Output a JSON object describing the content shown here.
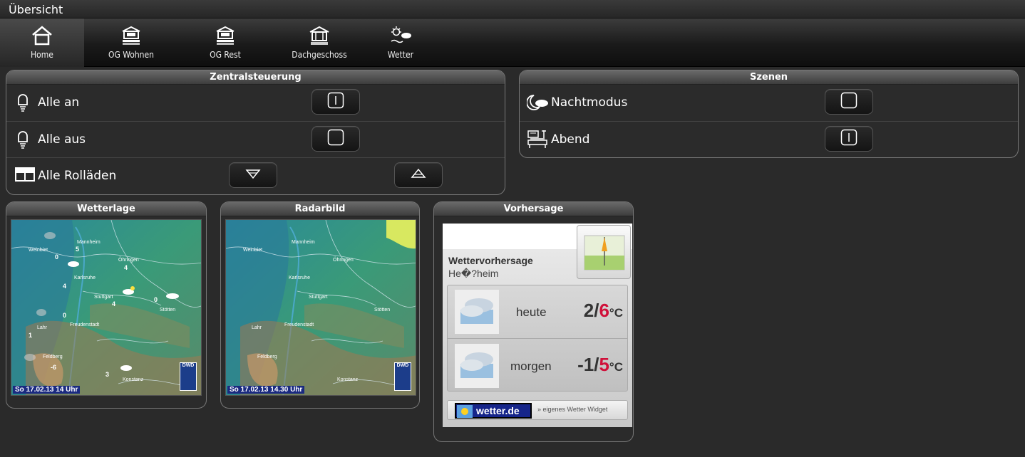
{
  "topbar": {
    "title": "Übersicht"
  },
  "nav": [
    {
      "label": "Home",
      "icon": "home-icon"
    },
    {
      "label": "OG Wohnen",
      "icon": "floor-icon"
    },
    {
      "label": "OG Rest",
      "icon": "floor-icon"
    },
    {
      "label": "Dachgeschoss",
      "icon": "attic-icon"
    },
    {
      "label": "Wetter",
      "icon": "weather-icon"
    }
  ],
  "zentral": {
    "title": "Zentralsteuerung",
    "rows": [
      {
        "label": "Alle an",
        "icon": "bulb-icon"
      },
      {
        "label": "Alle aus",
        "icon": "bulb-icon"
      },
      {
        "label": "Alle Rolläden",
        "icon": "window-icon"
      }
    ]
  },
  "szenen": {
    "title": "Szenen",
    "rows": [
      {
        "label": "Nachtmodus",
        "icon": "moon-cloud-icon"
      },
      {
        "label": "Abend",
        "icon": "evening-icon"
      }
    ]
  },
  "wetterlage": {
    "title": "Wetterlage",
    "stamp": "So 17.02.13 14 Uhr",
    "logo": "DWD",
    "cities": [
      "Mannheim",
      "Weinbiet",
      "Öhringen",
      "Karlsruhe",
      "Stuttgart",
      "Stötten",
      "Freudenstadt",
      "Lahr",
      "Feldberg",
      "Konstanz"
    ],
    "temps": [
      "5",
      "0",
      "4",
      "4",
      "4",
      "0",
      "0",
      "1",
      "-6",
      "3"
    ]
  },
  "radar": {
    "title": "Radarbild",
    "stamp": "So 17.02.13 14.30 Uhr",
    "logo": "DWD",
    "cities": [
      "Mannheim",
      "Weinbiet",
      "Öhringen",
      "Karlsruhe",
      "Stuttgart",
      "Stötten",
      "Freudenstadt",
      "Lahr",
      "Feldberg",
      "Konstanz"
    ]
  },
  "vorhersage": {
    "title": "Vorhersage",
    "heading": "Wettervorhersage",
    "location": "He�?heim",
    "days": [
      {
        "label": "heute",
        "min": "2",
        "max": "6",
        "unit": "°C"
      },
      {
        "label": "morgen",
        "min": "-1",
        "max": "5",
        "unit": "°C"
      }
    ],
    "brand": "wetter.de",
    "widget_link": "» eigenes Wetter Widget",
    "max_color": "#d0103a"
  }
}
